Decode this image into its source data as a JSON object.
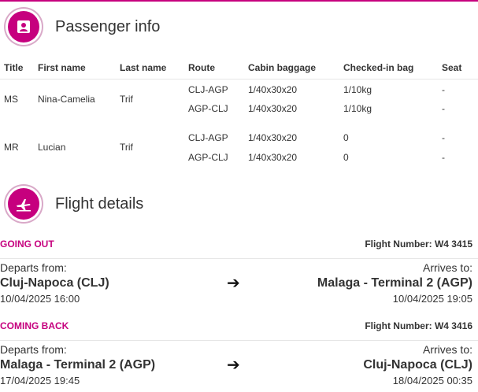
{
  "passenger_section": {
    "title": "Passenger info",
    "icon": "passenger-icon",
    "columns": [
      "Title",
      "First name",
      "Last name",
      "Route",
      "Cabin baggage",
      "Checked-in bag",
      "Seat"
    ],
    "passengers": [
      {
        "title": "MS",
        "first_name": "Nina-Camelia",
        "last_name": "Trif",
        "legs": [
          {
            "route": "CLJ-AGP",
            "cabin": "1/40x30x20",
            "checked": "1/10kg",
            "seat": "-"
          },
          {
            "route": "AGP-CLJ",
            "cabin": "1/40x30x20",
            "checked": "1/10kg",
            "seat": "-"
          }
        ]
      },
      {
        "title": "MR",
        "first_name": "Lucian",
        "last_name": "Trif",
        "legs": [
          {
            "route": "CLJ-AGP",
            "cabin": "1/40x30x20",
            "checked": "0",
            "seat": "-"
          },
          {
            "route": "AGP-CLJ",
            "cabin": "1/40x30x20",
            "checked": "0",
            "seat": "-"
          }
        ]
      }
    ]
  },
  "flight_section": {
    "title": "Flight details",
    "icon": "airplane-icon",
    "outbound": {
      "label": "GOING OUT",
      "flight_number": "Flight Number: W4 3415",
      "departs_label": "Departs from:",
      "departs_city": "Cluj-Napoca (CLJ)",
      "departs_time": "10/04/2025 16:00",
      "arrives_label": "Arrives to:",
      "arrives_city": "Malaga - Terminal 2 (AGP)",
      "arrives_time": "10/04/2025 19:05",
      "arrow": "➔"
    },
    "return": {
      "label": "COMING BACK",
      "flight_number": "Flight Number: W4 3416",
      "departs_label": "Departs from:",
      "departs_city": "Malaga - Terminal 2 (AGP)",
      "departs_time": "17/04/2025 19:45",
      "arrives_label": "Arrives to:",
      "arrives_city": "Cluj-Napoca (CLJ)",
      "arrives_time": "18/04/2025 00:35",
      "arrow": "➔"
    }
  },
  "colors": {
    "brand": "#c6007e",
    "text": "#333333",
    "divider": "#e6e6e6"
  }
}
